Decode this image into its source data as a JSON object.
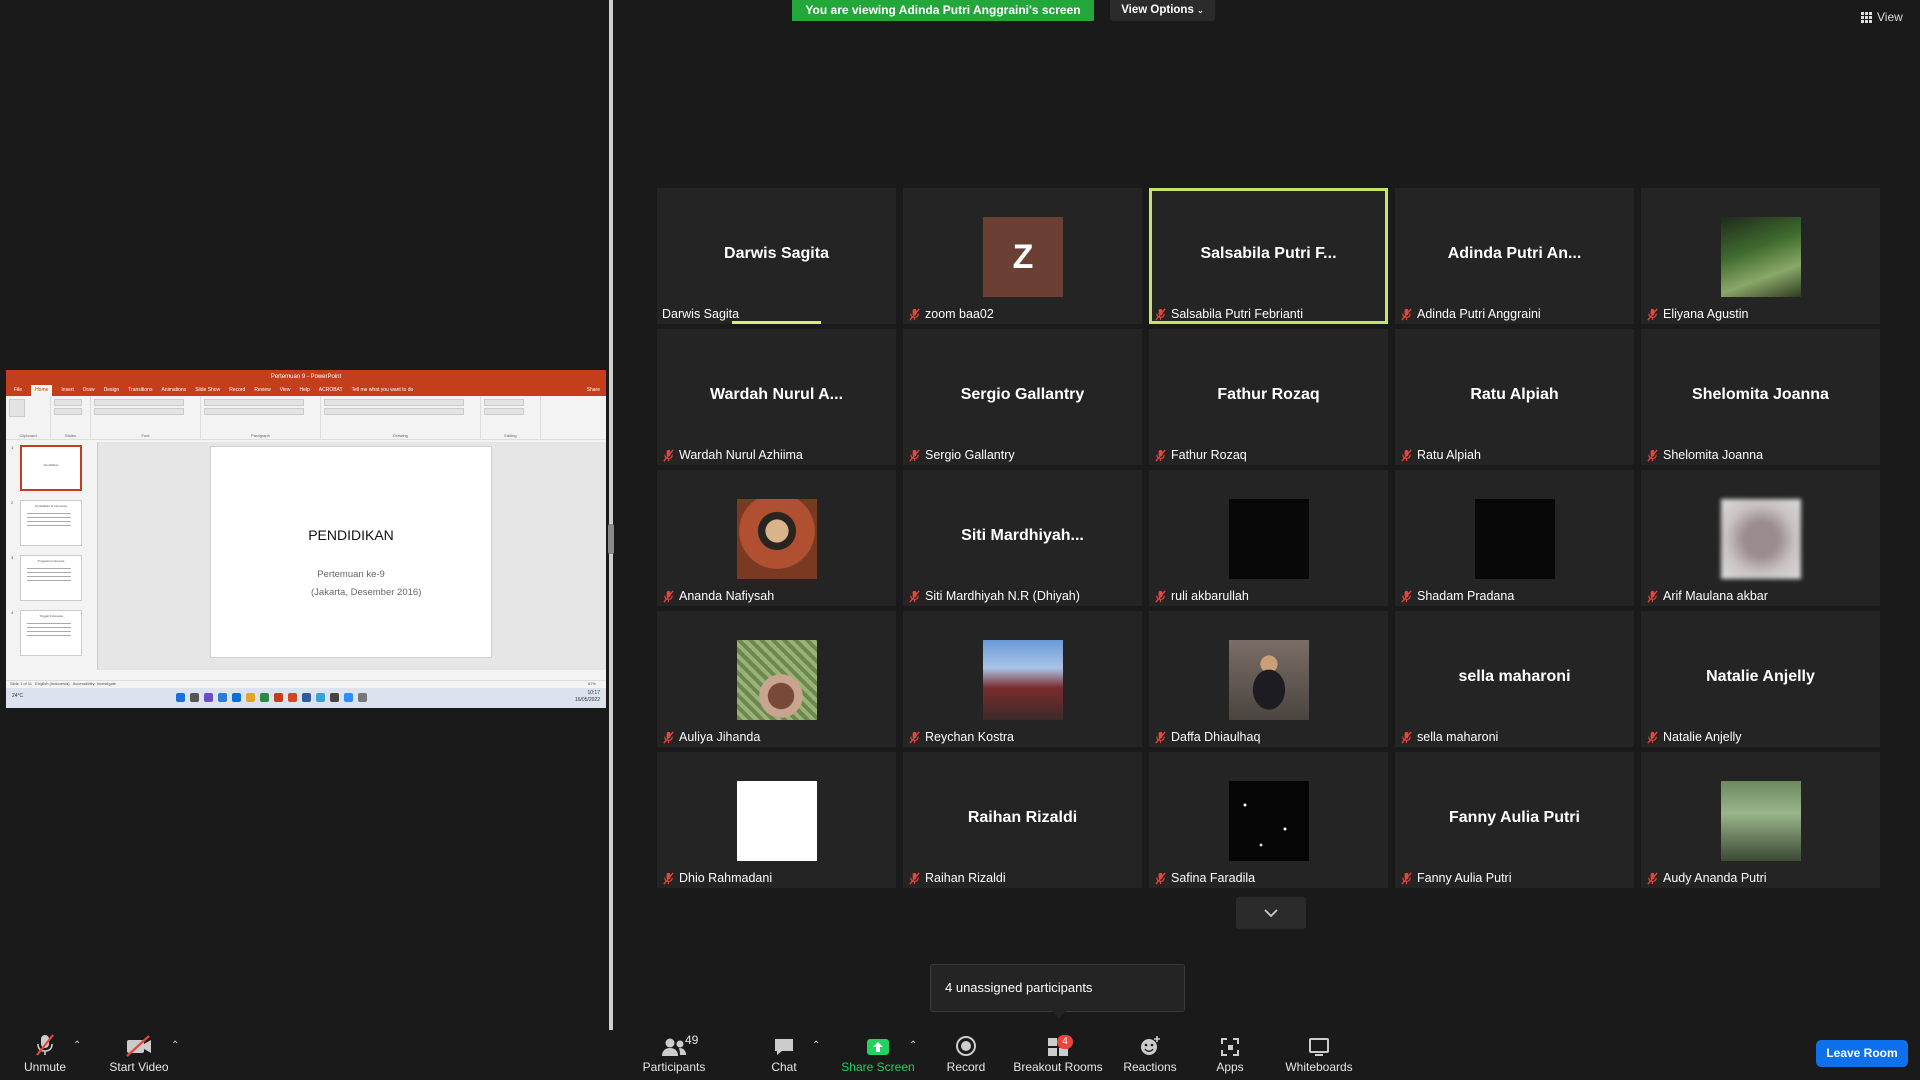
{
  "banner": {
    "viewing_text": "You are viewing Adinda Putri Anggraini's screen",
    "view_options": "View Options",
    "view_label": "View"
  },
  "shared_screen": {
    "window_title": "Pertemuan 9 - PowerPoint",
    "ribbon_tabs": [
      "File",
      "Home",
      "Insert",
      "Draw",
      "Design",
      "Transitions",
      "Animations",
      "Slide Show",
      "Record",
      "Review",
      "View",
      "Help",
      "ACROBAT"
    ],
    "tell_me": "Tell me what you want to do",
    "share": "Share",
    "groups": [
      "Clipboard",
      "Slides",
      "Font",
      "Paragraph",
      "Drawing",
      "Editing"
    ],
    "slide_title": "PENDIDIKAN",
    "slide_line1": "Pertemuan ke-9",
    "slide_line2": "(Jakarta, Desember 2016)",
    "notes_placeholder": "Click to add notes",
    "status_left": "Slide 1 of 11",
    "status_lang": "English (Indonesia)",
    "status_access": "Accessibility: Investigate",
    "status_zoom": "67%",
    "taskbar_weather": "24°C",
    "taskbar_time": "10:17",
    "taskbar_date": "16/05/2022",
    "thumb_titles": [
      "Pendidikan",
      "Pendidikan di Indonesia",
      "Tinggalan Indonesia",
      "Tinggal Indonesia"
    ]
  },
  "participants": [
    {
      "tile": "Darwis Sagita",
      "name": "Darwis Sagita",
      "muted": false,
      "speaking": true,
      "avatar": "none"
    },
    {
      "tile": "Z",
      "name": "zoom baa02",
      "muted": true,
      "avatar": "letter"
    },
    {
      "tile": "Salsabila Putri F...",
      "name": "Salsabila Putri Febrianti",
      "muted": true,
      "active": true,
      "avatar": "none"
    },
    {
      "tile": "Adinda Putri An...",
      "name": "Adinda Putri Anggraini",
      "muted": true,
      "avatar": "none"
    },
    {
      "tile": "",
      "name": "Eliyana Agustin",
      "muted": true,
      "avatar": "photo1"
    },
    {
      "tile": "Wardah Nurul A...",
      "name": "Wardah Nurul Azhiima",
      "muted": true,
      "avatar": "none"
    },
    {
      "tile": "Sergio Gallantry",
      "name": "Sergio Gallantry",
      "muted": true,
      "avatar": "none"
    },
    {
      "tile": "Fathur Rozaq",
      "name": "Fathur Rozaq",
      "muted": true,
      "avatar": "none"
    },
    {
      "tile": "Ratu Alpiah",
      "name": "Ratu Alpiah",
      "muted": true,
      "avatar": "none"
    },
    {
      "tile": "Shelomita Joanna",
      "name": "Shelomita Joanna",
      "muted": true,
      "avatar": "none"
    },
    {
      "tile": "",
      "name": "Ananda Nafiysah",
      "muted": true,
      "avatar": "photo2"
    },
    {
      "tile": "Siti Mardhiyah...",
      "name": "Siti Mardhiyah N.R (Dhiyah)",
      "muted": true,
      "avatar": "none"
    },
    {
      "tile": "",
      "name": "ruli akbarullah",
      "muted": true,
      "avatar": "photo3"
    },
    {
      "tile": "",
      "name": "Shadam Pradana",
      "muted": true,
      "avatar": "photo3"
    },
    {
      "tile": "",
      "name": "Arif Maulana akbar",
      "muted": true,
      "avatar": "photo4"
    },
    {
      "tile": "",
      "name": "Auliya Jihanda",
      "muted": true,
      "avatar": "photo5"
    },
    {
      "tile": "",
      "name": "Reychan Kostra",
      "muted": true,
      "avatar": "photo6"
    },
    {
      "tile": "",
      "name": "Daffa Dhiaulhaq",
      "muted": true,
      "avatar": "photo7"
    },
    {
      "tile": "sella maharoni",
      "name": "sella maharoni",
      "muted": true,
      "avatar": "none"
    },
    {
      "tile": "Natalie Anjelly",
      "name": "Natalie Anjelly",
      "muted": true,
      "avatar": "none"
    },
    {
      "tile": "",
      "name": "Dhio Rahmadani",
      "muted": true,
      "avatar": "photo8"
    },
    {
      "tile": "Raihan Rizaldi",
      "name": "Raihan Rizaldi",
      "muted": true,
      "avatar": "none"
    },
    {
      "tile": "",
      "name": "Safina Faradila",
      "muted": true,
      "avatar": "photo9"
    },
    {
      "tile": "Fanny Aulia Putri",
      "name": "Fanny Aulia Putri",
      "muted": true,
      "avatar": "none"
    },
    {
      "tile": "",
      "name": "Audy Ananda Putri",
      "muted": true,
      "avatar": "photo10"
    }
  ],
  "tooltip": {
    "text": "4 unassigned participants"
  },
  "toolbar": {
    "unmute": "Unmute",
    "start_video": "Start Video",
    "participants": "Participants",
    "participants_count": "49",
    "chat": "Chat",
    "share_screen": "Share Screen",
    "record": "Record",
    "breakout_rooms": "Breakout Rooms",
    "breakout_badge": "4",
    "reactions": "Reactions",
    "apps": "Apps",
    "whiteboards": "Whiteboards",
    "leave_room": "Leave Room"
  },
  "colors": {
    "banner_green": "#23a73b",
    "active_speaker": "#c7e36a",
    "muted_red": "#e8453c",
    "leave_blue": "#0e71eb",
    "share_green": "#23d160"
  }
}
